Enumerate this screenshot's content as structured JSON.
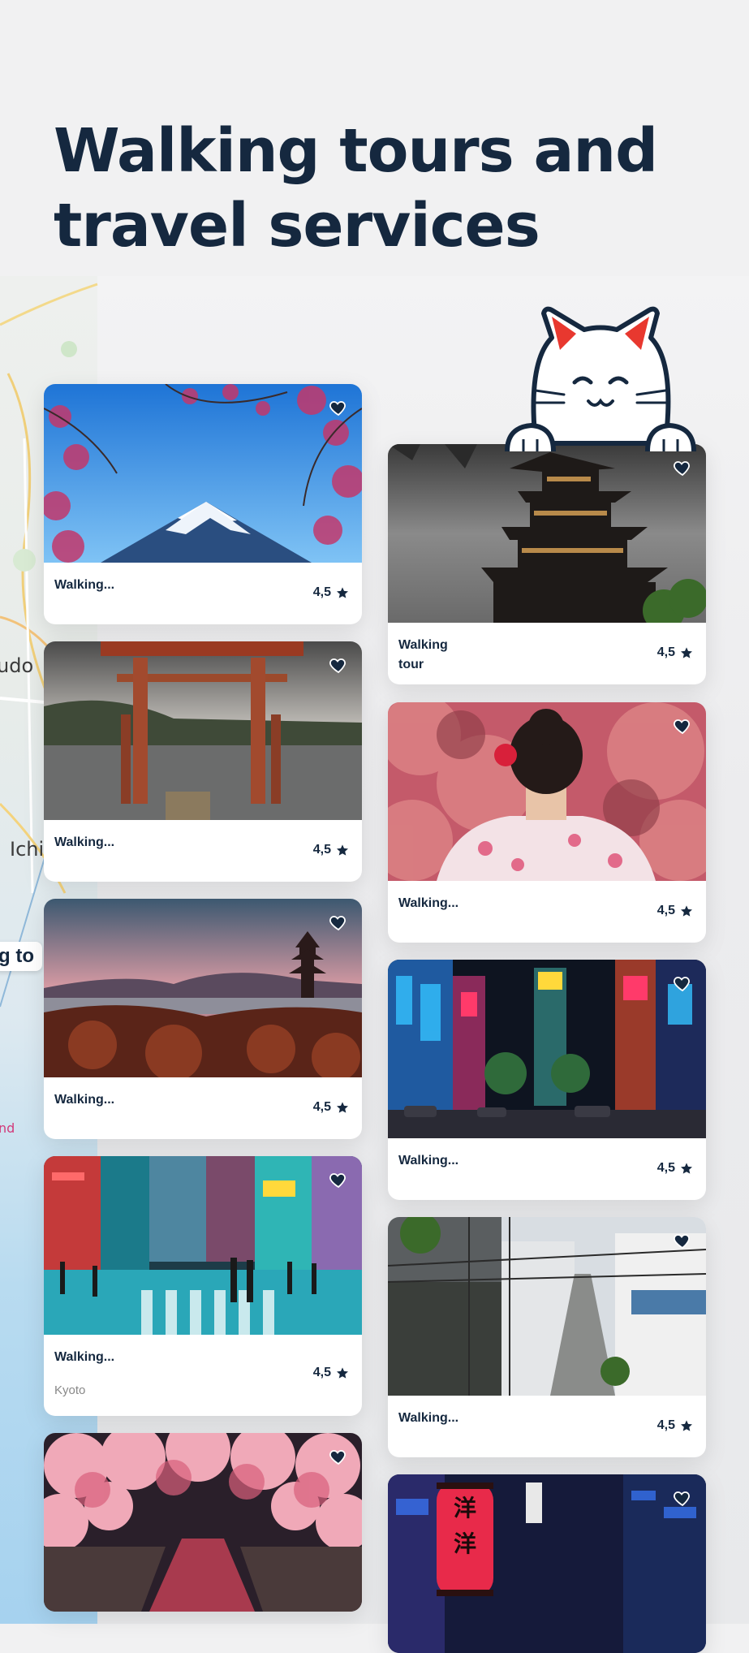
{
  "hero": {
    "title_line1": "Walking tours and",
    "title_line2": "travel services"
  },
  "map": {
    "label_1": "udo",
    "label_2": "Ichi",
    "label_3": "g to",
    "label_4": "nd"
  },
  "colors": {
    "brand_navy": "#15283f",
    "background": "#f1f1f2",
    "cat_ear": "#e8382f"
  },
  "cards_left": [
    {
      "title": "Walking...",
      "rating": "4,5",
      "image": "mount-fuji-cherry-blossom"
    },
    {
      "title": "Walking...",
      "rating": "4,5",
      "image": "torii-gate-lake"
    },
    {
      "title": "Walking...",
      "rating": "4,5",
      "image": "pagoda-sunset-city"
    },
    {
      "title": "Walking...",
      "rating": "4,5",
      "subtitle": "Kyoto",
      "image": "neon-street-crossing"
    },
    {
      "title": "",
      "rating": "",
      "image": "cherry-blossom-canal"
    }
  ],
  "cards_right": [
    {
      "title": "Walking\ntour",
      "rating": "4,5",
      "image": "japanese-castle"
    },
    {
      "title": "Walking...",
      "rating": "4,5",
      "image": "woman-in-kimono"
    },
    {
      "title": "Walking...",
      "rating": "4,5",
      "image": "shibuya-night"
    },
    {
      "title": "Walking...",
      "rating": "4,5",
      "image": "tokyo-alley"
    },
    {
      "title": "",
      "rating": "",
      "image": "red-lantern-alley",
      "lantern_text": "洋\n洋"
    }
  ],
  "icons": {
    "favorite": "heart-icon",
    "rating": "star-icon",
    "mascot": "lucky-cat-icon"
  }
}
